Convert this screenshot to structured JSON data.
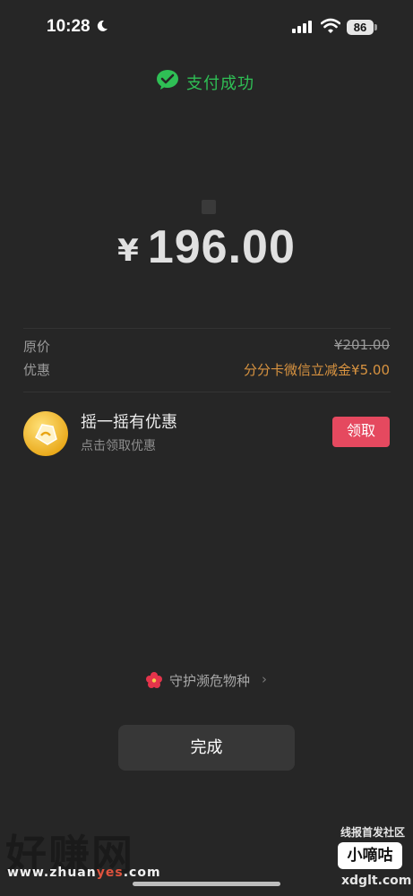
{
  "status_bar": {
    "time": "10:28",
    "battery": "86"
  },
  "header": {
    "title": "支付成功"
  },
  "payment": {
    "currency": "¥",
    "amount": "196.00"
  },
  "details": {
    "original_label": "原价",
    "original_value": "¥201.00",
    "discount_label": "优惠",
    "discount_value": "分分卡微信立减金¥5.00"
  },
  "promo": {
    "title": "摇一摇有优惠",
    "subtitle": "点击领取优惠",
    "button": "领取"
  },
  "footer": {
    "protect_label": "守护濒危物种",
    "chevron": "›",
    "done_button": "完成"
  },
  "watermarks": {
    "left_logo": "好赚网",
    "left_url_prefix": "www.zhuan",
    "left_url_highlight": "yes",
    "left_url_suffix": ".com",
    "right_caption": "线报首发社区",
    "right_logo": "小嘀咕",
    "right_url": "xdglt.com"
  },
  "colors": {
    "background": "#262626",
    "success_green": "#2fbf55",
    "discount_orange": "#d89340",
    "claim_red": "#e5495f",
    "done_gray": "#373737"
  },
  "icons": [
    "moon-icon",
    "cellular-signal-icon",
    "wifi-icon",
    "battery-icon",
    "wechat-pay-icon",
    "shake-coupon-icon",
    "flower-icon",
    "chevron-right-icon"
  ]
}
